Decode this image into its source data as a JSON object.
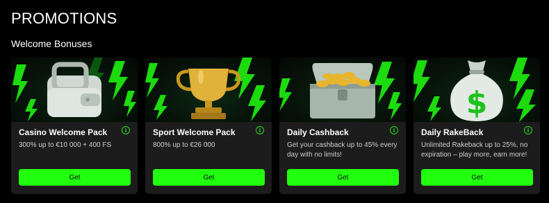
{
  "header": {
    "title": "PROMOTIONS"
  },
  "section": {
    "title": "Welcome Bonuses"
  },
  "colors": {
    "accent": "#21ff0f",
    "card_bg": "#1c1c1c",
    "page_bg": "#000000"
  },
  "cards": [
    {
      "icon": "wallet-icon",
      "title": "Casino Welcome Pack",
      "desc": "300% up to €10 000 + 400 FS",
      "button": "Get"
    },
    {
      "icon": "trophy-icon",
      "title": "Sport Welcome Pack",
      "desc": "800% up to €26 000",
      "button": "Get"
    },
    {
      "icon": "treasure-chest-icon",
      "title": "Daily Cashback",
      "desc": "Get your cashback up to 45% every day with no limits!",
      "button": "Get"
    },
    {
      "icon": "money-bag-icon",
      "title": "Daily RakeBack",
      "desc": "Unlimited Rakeback up to 25%, no expiration – play more, earn more!",
      "button": "Get"
    }
  ],
  "info_glyph": "i"
}
